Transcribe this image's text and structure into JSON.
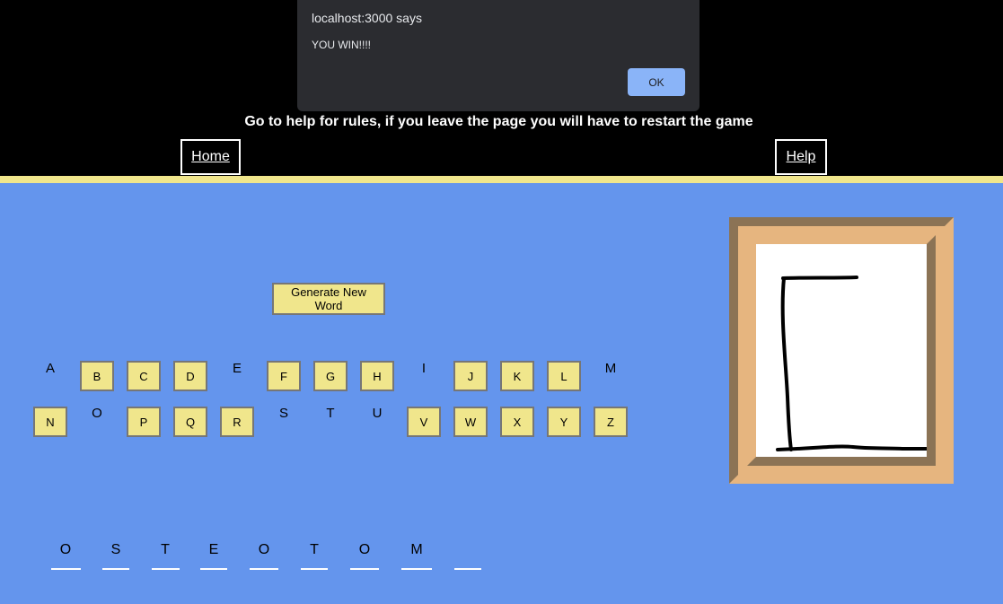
{
  "alert": {
    "title": "localhost:3000 says",
    "message": "YOU WIN!!!!",
    "ok_label": "OK"
  },
  "header": {
    "subtitle": "Go to help for rules, if you leave the page you will have to restart the game",
    "home_label": "Home",
    "help_label": "Help"
  },
  "game": {
    "generate_label": "Generate New Word",
    "row1": [
      {
        "letter": "A",
        "used": true
      },
      {
        "letter": "B",
        "used": false
      },
      {
        "letter": "C",
        "used": false
      },
      {
        "letter": "D",
        "used": false
      },
      {
        "letter": "E",
        "used": true
      },
      {
        "letter": "F",
        "used": false
      },
      {
        "letter": "G",
        "used": false
      },
      {
        "letter": "H",
        "used": false
      },
      {
        "letter": "I",
        "used": true
      },
      {
        "letter": "J",
        "used": false
      },
      {
        "letter": "K",
        "used": false
      },
      {
        "letter": "L",
        "used": false
      },
      {
        "letter": "M",
        "used": true
      }
    ],
    "row2": [
      {
        "letter": "N",
        "used": false
      },
      {
        "letter": "O",
        "used": true
      },
      {
        "letter": "P",
        "used": false
      },
      {
        "letter": "Q",
        "used": false
      },
      {
        "letter": "R",
        "used": false
      },
      {
        "letter": "S",
        "used": true
      },
      {
        "letter": "T",
        "used": true
      },
      {
        "letter": "U",
        "used": true
      },
      {
        "letter": "V",
        "used": false
      },
      {
        "letter": "W",
        "used": false
      },
      {
        "letter": "X",
        "used": false
      },
      {
        "letter": "Y",
        "used": false
      },
      {
        "letter": "Z",
        "used": false
      }
    ],
    "word_slots": [
      "O",
      "S",
      "T",
      "E",
      "O",
      "T",
      "O",
      "M",
      ""
    ]
  },
  "colors": {
    "background": "#6495ed",
    "header": "#000000",
    "accent": "#f0e68c",
    "frame_dark": "#8b7355",
    "frame_light": "#e6b57f"
  }
}
